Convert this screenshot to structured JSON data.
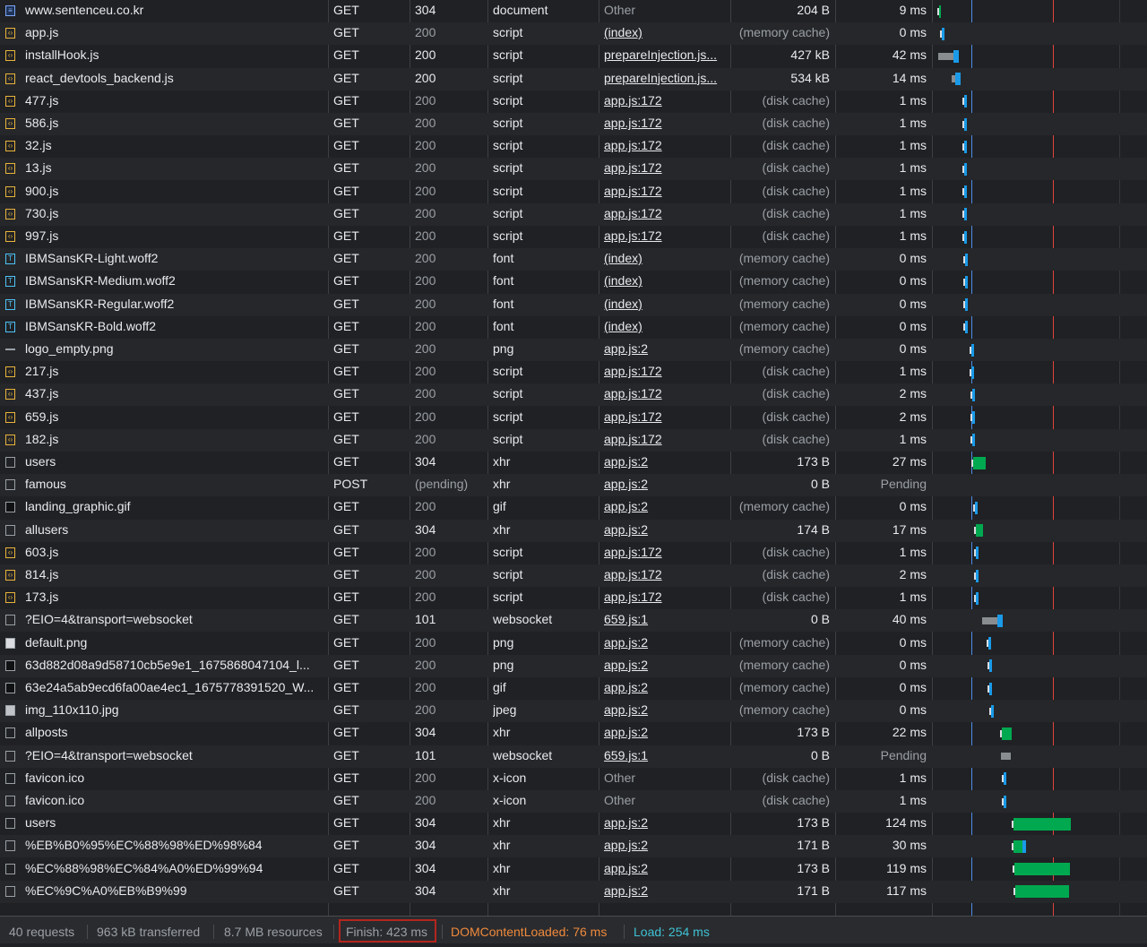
{
  "requests": [
    {
      "name": "www.sentenceu.co.kr",
      "method": "GET",
      "status": "304",
      "type": "document",
      "initiator": "Other",
      "size": "204 B",
      "time": "9 ms",
      "icon": "document-icon",
      "cached": false,
      "link": false
    },
    {
      "name": "app.js",
      "method": "GET",
      "status": "200",
      "type": "script",
      "initiator": "(index)",
      "size": "(memory cache)",
      "time": "0 ms",
      "icon": "script-icon",
      "cached": false,
      "link": true
    },
    {
      "name": "installHook.js",
      "method": "GET",
      "status": "200",
      "type": "script",
      "initiator": "prepareInjection.js...",
      "size": "427 kB",
      "time": "42 ms",
      "icon": "script-icon",
      "cached": false,
      "link": true
    },
    {
      "name": "react_devtools_backend.js",
      "method": "GET",
      "status": "200",
      "type": "script",
      "initiator": "prepareInjection.js...",
      "size": "534 kB",
      "time": "14 ms",
      "icon": "script-icon",
      "cached": false,
      "link": true
    },
    {
      "name": "477.js",
      "method": "GET",
      "status": "200",
      "type": "script",
      "initiator": "app.js:172",
      "size": "(disk cache)",
      "time": "1 ms",
      "icon": "script-icon",
      "cached": true,
      "link": true
    },
    {
      "name": "586.js",
      "method": "GET",
      "status": "200",
      "type": "script",
      "initiator": "app.js:172",
      "size": "(disk cache)",
      "time": "1 ms",
      "icon": "script-icon",
      "cached": true,
      "link": true
    },
    {
      "name": "32.js",
      "method": "GET",
      "status": "200",
      "type": "script",
      "initiator": "app.js:172",
      "size": "(disk cache)",
      "time": "1 ms",
      "icon": "script-icon",
      "cached": true,
      "link": true
    },
    {
      "name": "13.js",
      "method": "GET",
      "status": "200",
      "type": "script",
      "initiator": "app.js:172",
      "size": "(disk cache)",
      "time": "1 ms",
      "icon": "script-icon",
      "cached": true,
      "link": true
    },
    {
      "name": "900.js",
      "method": "GET",
      "status": "200",
      "type": "script",
      "initiator": "app.js:172",
      "size": "(disk cache)",
      "time": "1 ms",
      "icon": "script-icon",
      "cached": true,
      "link": true
    },
    {
      "name": "730.js",
      "method": "GET",
      "status": "200",
      "type": "script",
      "initiator": "app.js:172",
      "size": "(disk cache)",
      "time": "1 ms",
      "icon": "script-icon",
      "cached": true,
      "link": true
    },
    {
      "name": "997.js",
      "method": "GET",
      "status": "200",
      "type": "script",
      "initiator": "app.js:172",
      "size": "(disk cache)",
      "time": "1 ms",
      "icon": "script-icon",
      "cached": true,
      "link": true
    },
    {
      "name": "IBMSansKR-Light.woff2",
      "method": "GET",
      "status": "200",
      "type": "font",
      "initiator": "(index)",
      "size": "(memory cache)",
      "time": "0 ms",
      "icon": "font-icon",
      "cached": false,
      "link": true
    },
    {
      "name": "IBMSansKR-Medium.woff2",
      "method": "GET",
      "status": "200",
      "type": "font",
      "initiator": "(index)",
      "size": "(memory cache)",
      "time": "0 ms",
      "icon": "font-icon",
      "cached": false,
      "link": true
    },
    {
      "name": "IBMSansKR-Regular.woff2",
      "method": "GET",
      "status": "200",
      "type": "font",
      "initiator": "(index)",
      "size": "(memory cache)",
      "time": "0 ms",
      "icon": "font-icon",
      "cached": false,
      "link": true
    },
    {
      "name": "IBMSansKR-Bold.woff2",
      "method": "GET",
      "status": "200",
      "type": "font",
      "initiator": "(index)",
      "size": "(memory cache)",
      "time": "0 ms",
      "icon": "font-icon",
      "cached": false,
      "link": true
    },
    {
      "name": "logo_empty.png",
      "method": "GET",
      "status": "200",
      "type": "png",
      "initiator": "app.js:2",
      "size": "(memory cache)",
      "time": "0 ms",
      "icon": "empty-image-icon",
      "cached": false,
      "link": true
    },
    {
      "name": "217.js",
      "method": "GET",
      "status": "200",
      "type": "script",
      "initiator": "app.js:172",
      "size": "(disk cache)",
      "time": "1 ms",
      "icon": "script-icon",
      "cached": true,
      "link": true
    },
    {
      "name": "437.js",
      "method": "GET",
      "status": "200",
      "type": "script",
      "initiator": "app.js:172",
      "size": "(disk cache)",
      "time": "2 ms",
      "icon": "script-icon",
      "cached": true,
      "link": true
    },
    {
      "name": "659.js",
      "method": "GET",
      "status": "200",
      "type": "script",
      "initiator": "app.js:172",
      "size": "(disk cache)",
      "time": "2 ms",
      "icon": "script-icon",
      "cached": true,
      "link": true
    },
    {
      "name": "182.js",
      "method": "GET",
      "status": "200",
      "type": "script",
      "initiator": "app.js:172",
      "size": "(disk cache)",
      "time": "1 ms",
      "icon": "script-icon",
      "cached": true,
      "link": true
    },
    {
      "name": "users",
      "method": "GET",
      "status": "304",
      "type": "xhr",
      "initiator": "app.js:2",
      "size": "173 B",
      "time": "27 ms",
      "icon": "xhr-icon",
      "cached": false,
      "link": true
    },
    {
      "name": "famous",
      "method": "POST",
      "status": "(pending)",
      "type": "xhr",
      "initiator": "app.js:2",
      "size": "0 B",
      "time": "Pending",
      "icon": "xhr-icon",
      "cached": false,
      "link": true,
      "pending": true
    },
    {
      "name": "landing_graphic.gif",
      "method": "GET",
      "status": "200",
      "type": "gif",
      "initiator": "app.js:2",
      "size": "(memory cache)",
      "time": "0 ms",
      "icon": "image-icon",
      "cached": false,
      "link": true
    },
    {
      "name": "allusers",
      "method": "GET",
      "status": "304",
      "type": "xhr",
      "initiator": "app.js:2",
      "size": "174 B",
      "time": "17 ms",
      "icon": "xhr-icon",
      "cached": false,
      "link": true
    },
    {
      "name": "603.js",
      "method": "GET",
      "status": "200",
      "type": "script",
      "initiator": "app.js:172",
      "size": "(disk cache)",
      "time": "1 ms",
      "icon": "script-icon",
      "cached": true,
      "link": true
    },
    {
      "name": "814.js",
      "method": "GET",
      "status": "200",
      "type": "script",
      "initiator": "app.js:172",
      "size": "(disk cache)",
      "time": "2 ms",
      "icon": "script-icon",
      "cached": true,
      "link": true
    },
    {
      "name": "173.js",
      "method": "GET",
      "status": "200",
      "type": "script",
      "initiator": "app.js:172",
      "size": "(disk cache)",
      "time": "1 ms",
      "icon": "script-icon",
      "cached": true,
      "link": true
    },
    {
      "name": "?EIO=4&transport=websocket",
      "method": "GET",
      "status": "101",
      "type": "websocket",
      "initiator": "659.js:1",
      "size": "0 B",
      "time": "40 ms",
      "icon": "websocket-icon",
      "cached": false,
      "link": true
    },
    {
      "name": "default.png",
      "method": "GET",
      "status": "200",
      "type": "png",
      "initiator": "app.js:2",
      "size": "(memory cache)",
      "time": "0 ms",
      "icon": "image-icon",
      "cached": false,
      "link": true
    },
    {
      "name": "63d882d08a9d58710cb5e9e1_1675868047104_l...",
      "method": "GET",
      "status": "200",
      "type": "png",
      "initiator": "app.js:2",
      "size": "(memory cache)",
      "time": "0 ms",
      "icon": "image-icon",
      "cached": false,
      "link": true
    },
    {
      "name": "63e24a5ab9ecd6fa00ae4ec1_1675778391520_W...",
      "method": "GET",
      "status": "200",
      "type": "gif",
      "initiator": "app.js:2",
      "size": "(memory cache)",
      "time": "0 ms",
      "icon": "image-icon",
      "cached": false,
      "link": true
    },
    {
      "name": "img_110x110.jpg",
      "method": "GET",
      "status": "200",
      "type": "jpeg",
      "initiator": "app.js:2",
      "size": "(memory cache)",
      "time": "0 ms",
      "icon": "photo-icon",
      "cached": false,
      "link": true
    },
    {
      "name": "allposts",
      "method": "GET",
      "status": "304",
      "type": "xhr",
      "initiator": "app.js:2",
      "size": "173 B",
      "time": "22 ms",
      "icon": "xhr-icon",
      "cached": false,
      "link": true
    },
    {
      "name": "?EIO=4&transport=websocket",
      "method": "GET",
      "status": "101",
      "type": "websocket",
      "initiator": "659.js:1",
      "size": "0 B",
      "time": "Pending",
      "icon": "websocket-icon",
      "cached": false,
      "link": true,
      "pending": true
    },
    {
      "name": "favicon.ico",
      "method": "GET",
      "status": "200",
      "type": "x-icon",
      "initiator": "Other",
      "size": "(disk cache)",
      "time": "1 ms",
      "icon": "favicon-icon",
      "cached": true,
      "link": false
    },
    {
      "name": "favicon.ico",
      "method": "GET",
      "status": "200",
      "type": "x-icon",
      "initiator": "Other",
      "size": "(disk cache)",
      "time": "1 ms",
      "icon": "favicon-icon",
      "cached": true,
      "link": false
    },
    {
      "name": "users",
      "method": "GET",
      "status": "304",
      "type": "xhr",
      "initiator": "app.js:2",
      "size": "173 B",
      "time": "124 ms",
      "icon": "xhr-icon",
      "cached": false,
      "link": true
    },
    {
      "name": "%EB%B0%95%EC%88%98%ED%98%84",
      "method": "GET",
      "status": "304",
      "type": "xhr",
      "initiator": "app.js:2",
      "size": "171 B",
      "time": "30 ms",
      "icon": "xhr-icon",
      "cached": false,
      "link": true
    },
    {
      "name": "%EC%88%98%EC%84%A0%ED%99%94",
      "method": "GET",
      "status": "304",
      "type": "xhr",
      "initiator": "app.js:2",
      "size": "173 B",
      "time": "119 ms",
      "icon": "xhr-icon",
      "cached": false,
      "link": true
    },
    {
      "name": "%EC%9C%A0%EB%B9%99",
      "method": "GET",
      "status": "304",
      "type": "xhr",
      "initiator": "app.js:2",
      "size": "171 B",
      "time": "117 ms",
      "icon": "xhr-icon",
      "cached": false,
      "link": true
    }
  ],
  "waterfall": [
    [
      0,
      2,
      "g"
    ],
    [
      6,
      1,
      "b"
    ],
    [
      2,
      40,
      "G"
    ],
    [
      32,
      14,
      "G"
    ],
    [
      54,
      1,
      "b"
    ],
    [
      54,
      1,
      "b"
    ],
    [
      54,
      1,
      "b"
    ],
    [
      54,
      1,
      "b"
    ],
    [
      54,
      1,
      "b"
    ],
    [
      54,
      1,
      "b"
    ],
    [
      54,
      1,
      "b"
    ],
    [
      56,
      0,
      "b"
    ],
    [
      56,
      0,
      "b"
    ],
    [
      56,
      0,
      "b"
    ],
    [
      56,
      0,
      "b"
    ],
    [
      70,
      0,
      "b"
    ],
    [
      70,
      1,
      "b"
    ],
    [
      71,
      2,
      "b"
    ],
    [
      71,
      2,
      "b"
    ],
    [
      71,
      1,
      "b"
    ],
    [
      74,
      27,
      "g"
    ],
    null,
    [
      78,
      0,
      "b"
    ],
    [
      79,
      17,
      "g"
    ],
    [
      80,
      1,
      "b"
    ],
    [
      80,
      2,
      "b"
    ],
    [
      80,
      1,
      "b"
    ],
    [
      98,
      40,
      "G"
    ],
    [
      106,
      0,
      "b"
    ],
    [
      108,
      0,
      "b"
    ],
    [
      108,
      0,
      "b"
    ],
    [
      112,
      0,
      "b"
    ],
    [
      136,
      22,
      "g"
    ],
    [
      137,
      15,
      "Gp"
    ],
    [
      140,
      1,
      "b"
    ],
    [
      140,
      1,
      "b"
    ],
    [
      161,
      124,
      "g"
    ],
    [
      162,
      30,
      "gb"
    ],
    [
      164,
      119,
      "g"
    ],
    [
      165,
      117,
      "g"
    ]
  ],
  "summary": {
    "requests": "40 requests",
    "transferred": "963 kB transferred",
    "resources": "8.7 MB resources",
    "finish": "Finish: 423 ms",
    "dom": "DOMContentLoaded: 76 ms",
    "load": "Load: 254 ms"
  },
  "colors": {
    "dom": "#f08a3c",
    "load": "#3ec2d5",
    "waiting": "#00a94f",
    "download": "#1a9ae8",
    "queue": "#8a8d90"
  }
}
